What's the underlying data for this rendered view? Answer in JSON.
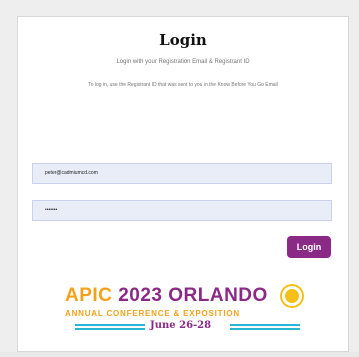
{
  "login": {
    "title": "Login",
    "subtitle": "Login with your Registration Email & Registrant ID",
    "instructions": "To log in, use the Registrant ID that was sent to you in the Know Before You Go Email",
    "email_value": "peter@cadmiumcd.com",
    "password_value": "•••••••",
    "button_label": "Login"
  },
  "logo": {
    "apic": "APIC",
    "year": "2023",
    "city": "ORLANDO",
    "tagline": "ANNUAL CONFERENCE & EXPOSITION",
    "dates": "June 26-28"
  },
  "colors": {
    "accent_purple": "#8b2a86",
    "accent_orange": "#f3a21b",
    "accent_teal": "#29b6d6"
  }
}
